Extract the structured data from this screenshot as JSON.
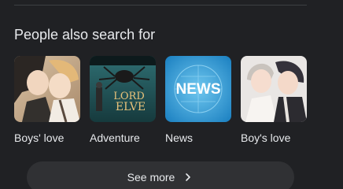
{
  "section": {
    "title": "People also search for"
  },
  "cards": [
    {
      "label": "Boys' love"
    },
    {
      "label": "Adventure",
      "thumb_text": "LORD\nELVE"
    },
    {
      "label": "News",
      "thumb_text": "NEWS"
    },
    {
      "label": "Boy's love"
    }
  ],
  "see_more": {
    "label": "See more",
    "icon": "chevron-right-icon"
  }
}
